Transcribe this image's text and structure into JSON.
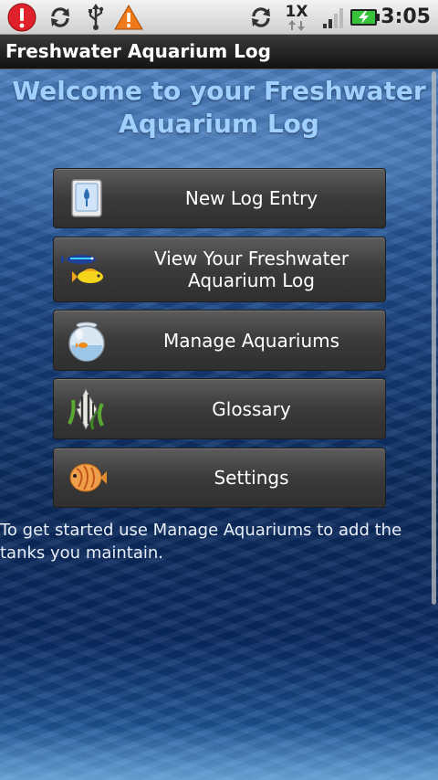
{
  "status_bar": {
    "time": "3:05",
    "network_label": "1X",
    "icons": [
      "alert-icon",
      "sync-icon",
      "usb-icon",
      "warning-icon",
      "sync-active-icon",
      "signal-icon",
      "battery-charging-icon"
    ]
  },
  "title_bar": {
    "title": "Freshwater Aquarium Log"
  },
  "main": {
    "welcome_line1": "Welcome to your Freshwater",
    "welcome_line2": "Aquarium Log",
    "buttons": [
      {
        "label": "New Log Entry",
        "icon": "device-icon"
      },
      {
        "label_line1": "View Your Freshwater",
        "label_line2": "Aquarium Log",
        "icon": "fish-icon"
      },
      {
        "label": "Manage Aquariums",
        "icon": "fishbowl-icon"
      },
      {
        "label": "Glossary",
        "icon": "angelfish-icon"
      },
      {
        "label": "Settings",
        "icon": "discus-icon"
      }
    ],
    "info_text": "To get started use Manage Aquariums to add the tanks you maintain."
  },
  "colors": {
    "welcome_text": "#9fd0ff",
    "button_bg": "#3a3a3a",
    "alert_red": "#e0202a",
    "warning_orange": "#f07a1a",
    "battery_green": "#36c23a"
  }
}
